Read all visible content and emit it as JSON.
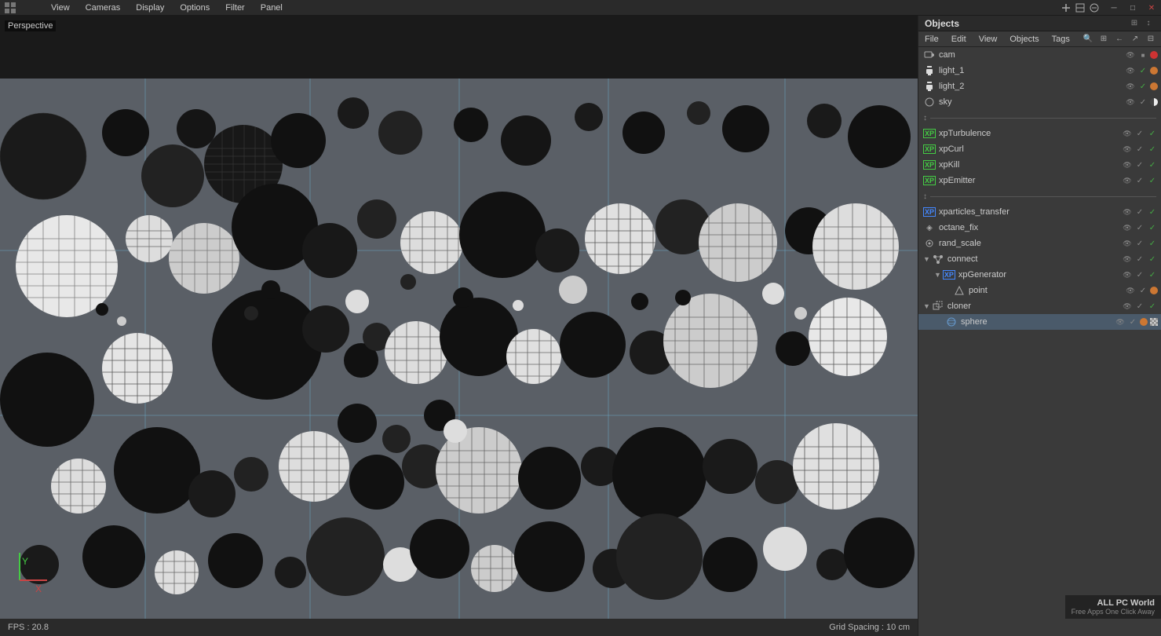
{
  "menubar": {
    "app_icon": "◼",
    "items": [
      "View",
      "Cameras",
      "Display",
      "Options",
      "Filter",
      "Panel"
    ],
    "win_icons": [
      "⊟",
      "⬜",
      "✕"
    ]
  },
  "viewport": {
    "label": "Perspective",
    "fps": "FPS : 20.8",
    "grid_spacing": "Grid Spacing : 10 cm",
    "axis": {
      "y": "Y",
      "x": "X"
    }
  },
  "objects_panel": {
    "title": "Objects",
    "menus": [
      "File",
      "Edit",
      "View",
      "Objects",
      "Tags"
    ],
    "items": [
      {
        "id": "cam",
        "name": "cam",
        "icon": "📷",
        "icon_type": "cam",
        "indent": 0,
        "controls": [
          "vis",
          "lock",
          "color"
        ],
        "dot": "red"
      },
      {
        "id": "light_1",
        "name": "light_1",
        "icon": "💡",
        "icon_type": "light",
        "indent": 0,
        "controls": [
          "vis",
          "lock",
          "color"
        ],
        "dot": "orange"
      },
      {
        "id": "light_2",
        "name": "light_2",
        "icon": "💡",
        "icon_type": "light",
        "indent": 0,
        "controls": [
          "vis",
          "lock",
          "color"
        ],
        "dot": "orange"
      },
      {
        "id": "sky",
        "name": "sky",
        "icon": "○",
        "icon_type": "sky",
        "indent": 0,
        "controls": [
          "vis",
          "lock",
          "color"
        ],
        "dot": "half"
      },
      {
        "id": "sep1",
        "type": "separator"
      },
      {
        "id": "xpTurbulence",
        "name": "xpTurbulence",
        "icon": "xp",
        "icon_type": "xp_green",
        "indent": 0,
        "controls": [
          "vis",
          "check",
          "check"
        ],
        "dot": ""
      },
      {
        "id": "xpCurl",
        "name": "xpCurl",
        "icon": "xp",
        "icon_type": "xp_green",
        "indent": 0,
        "controls": [
          "vis",
          "check",
          "check"
        ],
        "dot": ""
      },
      {
        "id": "xpKill",
        "name": "xpKill",
        "icon": "xp",
        "icon_type": "xp_green",
        "indent": 0,
        "controls": [
          "vis",
          "check",
          "check"
        ],
        "dot": ""
      },
      {
        "id": "xpEmitter",
        "name": "xpEmitter",
        "icon": "xp",
        "icon_type": "xp_green",
        "indent": 0,
        "controls": [
          "vis",
          "check",
          "check"
        ],
        "dot": ""
      },
      {
        "id": "sep2",
        "type": "separator"
      },
      {
        "id": "xparticles_transfer",
        "name": "xparticles_transfer",
        "icon": "xp",
        "icon_type": "xp_blue",
        "indent": 0,
        "controls": [
          "vis",
          "check",
          "check"
        ],
        "dot": ""
      },
      {
        "id": "octane_fix",
        "name": "octane_fix",
        "icon": "◈",
        "icon_type": "octane",
        "indent": 0,
        "controls": [
          "vis",
          "check",
          "check"
        ],
        "dot": ""
      },
      {
        "id": "rand_scale",
        "name": "rand_scale",
        "icon": "◉",
        "icon_type": "rand",
        "indent": 0,
        "controls": [
          "vis",
          "check",
          "check"
        ],
        "dot": ""
      },
      {
        "id": "connect",
        "name": "connect",
        "icon": "▷",
        "icon_type": "connect",
        "indent": 0,
        "controls": [
          "vis",
          "check",
          "check"
        ],
        "dot": "",
        "expanded": true
      },
      {
        "id": "xpGenerator",
        "name": "xpGenerator",
        "icon": "xp",
        "icon_type": "xp_blue",
        "indent": 1,
        "controls": [
          "vis",
          "check",
          "check"
        ],
        "dot": "",
        "expanded": true
      },
      {
        "id": "point",
        "name": "point",
        "icon": "△",
        "icon_type": "point",
        "indent": 2,
        "controls": [
          "vis",
          "check",
          "color"
        ],
        "dot": "orange"
      },
      {
        "id": "cloner",
        "name": "cloner",
        "icon": "▷",
        "icon_type": "cloner",
        "indent": 0,
        "controls": [
          "vis",
          "check",
          "check"
        ],
        "dot": "",
        "expanded": true
      },
      {
        "id": "sphere",
        "name": "sphere",
        "icon": "○",
        "icon_type": "sphere",
        "indent": 1,
        "controls": [
          "vis",
          "check",
          "color_checker"
        ],
        "dot": "checker"
      }
    ]
  },
  "watermark": {
    "line1": "ALL PC World",
    "line2": "Free Apps One Click Away"
  }
}
